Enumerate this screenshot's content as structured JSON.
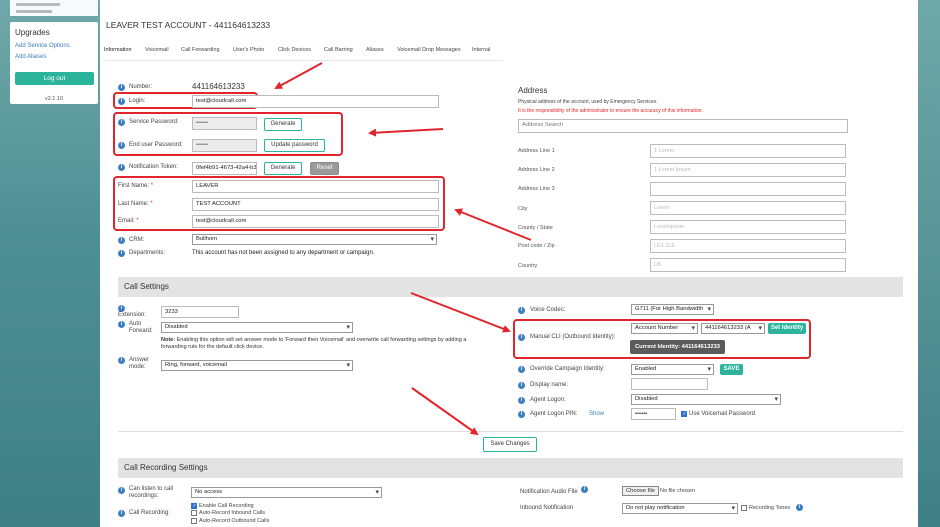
{
  "sidebar": {
    "heading": "Upgrades",
    "links": [
      "Add Service Options",
      "Add Aliases"
    ],
    "logout_label": "Log out",
    "version": "v2.1.10"
  },
  "page": {
    "title": "LEAVER TEST ACCOUNT - 441164613233",
    "tabs": [
      "Information",
      "Voicemail",
      "Call Forwarding",
      "User's Photo",
      "Click Devices",
      "Call Barring",
      "Aliases",
      "Voicemail Drop Messages",
      "Internal"
    ]
  },
  "info": {
    "number_label": "Number:",
    "number_value": "441164613233",
    "login_label": "Login:",
    "login_value": "test@cloudcall.com",
    "service_password_label": "Service Password:",
    "service_password_value": "••••••",
    "generate_label": "Generate",
    "end_user_password_label": "End user Password:",
    "end_user_password_value": "••••••",
    "update_password_label": "Update password",
    "notification_token_label": "Notification Token:",
    "notification_token_value": "0fef4b91-4673-42a4-b3",
    "reset_label": "Reset",
    "first_name_label": "First Name:",
    "first_name_value": "LEAVER",
    "last_name_label": "Last Name:",
    "last_name_value": "TEST ACCOUNT",
    "email_label": "Email:",
    "email_value": "test@cloudcall.com",
    "required_mark": "*",
    "crm_label": "CRM:",
    "crm_value": "Bullhorn",
    "departments_label": "Departments:",
    "departments_value": "This account has not been assigned to any department or campaign."
  },
  "address": {
    "heading": "Address",
    "desc": "Physical address of the account, used by Emergency Services.",
    "warning": "It is the responsibility of the administrator to ensure the accuracy of this information.",
    "search_placeholder": "Address Search",
    "fields": [
      {
        "label": "Address Line 1",
        "value": "1 Lorem"
      },
      {
        "label": "Address Line 2",
        "value": "1 Lorem Ipsum"
      },
      {
        "label": "Address Line 3",
        "value": ""
      },
      {
        "label": "City",
        "value": "Lorem"
      },
      {
        "label": "County / State",
        "value": "Loremipsum"
      },
      {
        "label": "Post code / Zip",
        "value": "LE1 1LE"
      },
      {
        "label": "Country",
        "value": "UK"
      }
    ]
  },
  "call_settings": {
    "heading": "Call Settings",
    "extension_label": "Extension:",
    "extension_value": "3233",
    "auto_forward_label": "Auto Forward:",
    "auto_forward_value": "Disabled",
    "note_bold": "Note:",
    "note_text": "Enabling this option will set answer mode to 'Forward then Voicemail' and overwrite call forwarding settings by adding a forwarding rule for the default click device.",
    "answer_mode_label": "Answer mode:",
    "answer_mode_value": "Ring, forward, voicemail",
    "voice_codec_label": "Voice Codec:",
    "voice_codec_value": "G711 (For High Bandwidth",
    "manual_cli_label": "Manual CLI (Outbound Identity):",
    "cli_type_value": "Account Number",
    "cli_number_value": "441164613233 (A",
    "set_identity_label": "Set Identity",
    "current_identity": "Current Identity: 441164613233",
    "override_label": "Override Campaign Identity:",
    "override_value": "Enabled",
    "save_label": "SAVE",
    "display_name_label": "Display name:",
    "agent_logon_label": "Agent Logon:",
    "agent_logon_value": "Disabled",
    "agent_pin_label": "Agent Logon PIN:",
    "show_label": "Show",
    "agent_pin_value": "••••••",
    "use_vm_password_label": "Use Voicemail Password",
    "save_changes_label": "Save Changes"
  },
  "recording": {
    "heading": "Call Recording Settings",
    "can_listen_label": "Can listen to call recordings:",
    "can_listen_value": "No access",
    "call_recording_label": "Call Recording:",
    "enable_label": "Enable Call Recording",
    "auto_inbound_label": "Auto-Record Inbound Calls",
    "auto_outbound_label": "Auto-Record Outbound Calls",
    "notif_audio_label": "Notification Audio File",
    "choose_file_label": "Choose file",
    "no_file_label": "No file chosen",
    "inbound_notif_label": "Inbound Notification",
    "inbound_notif_value": "Do not play notification",
    "recording_tones_label": "Recording Tones"
  },
  "colors": {
    "accent": "#2bb39b",
    "highlight": "#e0262c",
    "info_icon": "#3a7fbf"
  }
}
